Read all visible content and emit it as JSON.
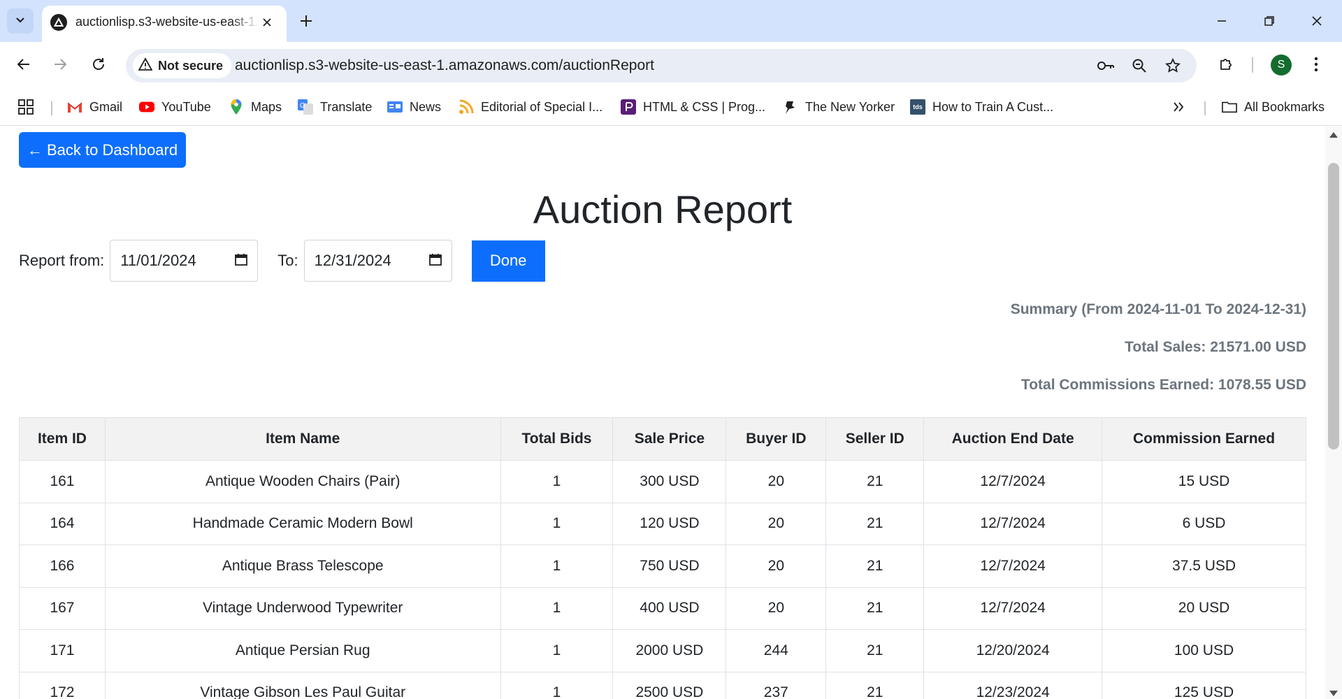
{
  "browser": {
    "tab_title": "auctionlisp.s3-website-us-east-1.amazonaws.com/auctionReport",
    "security_label": "Not secure",
    "url": "auctionlisp.s3-website-us-east-1.amazonaws.com/auctionReport",
    "profile_initial": "S",
    "bookmarks": [
      "Gmail",
      "YouTube",
      "Maps",
      "Translate",
      "News",
      "Editorial of Special I...",
      "HTML & CSS | Prog...",
      "The New Yorker",
      "How to Train A Cust..."
    ],
    "all_bookmarks": "All Bookmarks",
    "tds_badge": "tds"
  },
  "page": {
    "back_label": "← Back to Dashboard",
    "title": "Auction Report",
    "from_label": "Report from:",
    "from_value": "11/01/2024",
    "to_label": "To:",
    "to_value": "12/31/2024",
    "done_label": "Done"
  },
  "summary": {
    "range": "Summary (From 2024-11-01 To 2024-12-31)",
    "total_sales": "Total Sales: 21571.00 USD",
    "total_commissions": "Total Commissions Earned: 1078.55 USD"
  },
  "table": {
    "headers": [
      "Item ID",
      "Item Name",
      "Total Bids",
      "Sale Price",
      "Buyer ID",
      "Seller ID",
      "Auction End Date",
      "Commission Earned"
    ],
    "rows": [
      [
        "161",
        "Antique Wooden Chairs (Pair)",
        "1",
        "300 USD",
        "20",
        "21",
        "12/7/2024",
        "15 USD"
      ],
      [
        "164",
        "Handmade Ceramic Modern Bowl",
        "1",
        "120 USD",
        "20",
        "21",
        "12/7/2024",
        "6 USD"
      ],
      [
        "166",
        "Antique Brass Telescope",
        "1",
        "750 USD",
        "20",
        "21",
        "12/7/2024",
        "37.5 USD"
      ],
      [
        "167",
        "Vintage Underwood Typewriter",
        "1",
        "400 USD",
        "20",
        "21",
        "12/7/2024",
        "20 USD"
      ],
      [
        "171",
        "Antique Persian Rug",
        "1",
        "2000 USD",
        "244",
        "21",
        "12/20/2024",
        "100 USD"
      ],
      [
        "172",
        "Vintage Gibson Les Paul Guitar",
        "1",
        "2500 USD",
        "237",
        "21",
        "12/23/2024",
        "125 USD"
      ]
    ]
  },
  "colors": {
    "primary": "#0d6efd",
    "tabstrip": "#d3e3fd",
    "summary_text": "#6c757d",
    "header_bg": "#f2f2f2"
  }
}
